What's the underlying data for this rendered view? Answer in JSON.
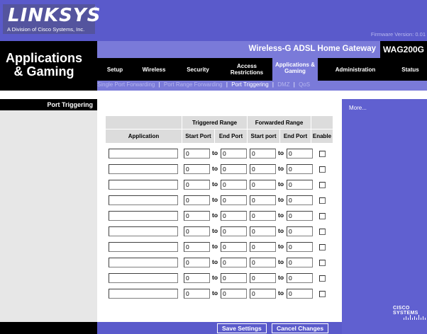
{
  "header": {
    "logo_text": "LINKSYS",
    "logo_reg": "®",
    "logo_sub": "A Division of Cisco Systems, Inc.",
    "firmware": "Firmware Version: 0.01"
  },
  "section": {
    "title_line1": "Applications",
    "title_line2": "& Gaming",
    "product_name": "Wireless-G ADSL Home Gateway",
    "model": "WAG200G"
  },
  "tabs": [
    {
      "label": "Setup"
    },
    {
      "label": "Wireless"
    },
    {
      "label": "Security"
    },
    {
      "label": "Access Restrictions"
    },
    {
      "label": "Applications & Gaming"
    },
    {
      "label": "Administration"
    },
    {
      "label": "Status"
    }
  ],
  "subnav": [
    {
      "label": "Single Port Forwarding"
    },
    {
      "label": "Port Range Forwarding"
    },
    {
      "label": "Port Triggering"
    },
    {
      "label": "DMZ"
    },
    {
      "label": "QoS"
    }
  ],
  "left_heading": "Port Triggering",
  "help": {
    "more": "More..."
  },
  "table": {
    "group_triggered": "Triggered Range",
    "group_forwarded": "Forwarded Range",
    "col_application": "Application",
    "col_trig_start": "Start Port",
    "col_trig_end": "End Port",
    "col_fwd_start": "Start port",
    "col_fwd_end": "End Port",
    "col_enable": "Enable",
    "to_label": "to",
    "rows": [
      {
        "app": "",
        "ts": "0",
        "te": "0",
        "fs": "0",
        "fe": "0"
      },
      {
        "app": "",
        "ts": "0",
        "te": "0",
        "fs": "0",
        "fe": "0"
      },
      {
        "app": "",
        "ts": "0",
        "te": "0",
        "fs": "0",
        "fe": "0"
      },
      {
        "app": "",
        "ts": "0",
        "te": "0",
        "fs": "0",
        "fe": "0"
      },
      {
        "app": "",
        "ts": "0",
        "te": "0",
        "fs": "0",
        "fe": "0"
      },
      {
        "app": "",
        "ts": "0",
        "te": "0",
        "fs": "0",
        "fe": "0"
      },
      {
        "app": "",
        "ts": "0",
        "te": "0",
        "fs": "0",
        "fe": "0"
      },
      {
        "app": "",
        "ts": "0",
        "te": "0",
        "fs": "0",
        "fe": "0"
      },
      {
        "app": "",
        "ts": "0",
        "te": "0",
        "fs": "0",
        "fe": "0"
      },
      {
        "app": "",
        "ts": "0",
        "te": "0",
        "fs": "0",
        "fe": "0"
      }
    ]
  },
  "buttons": {
    "save": "Save Settings",
    "cancel": "Cancel Changes"
  },
  "brand": {
    "cisco": "CISCO SYSTEMS"
  },
  "colors": {
    "accent": "#5a5acb",
    "tab_active": "#7a7ad9",
    "black": "#000000"
  }
}
